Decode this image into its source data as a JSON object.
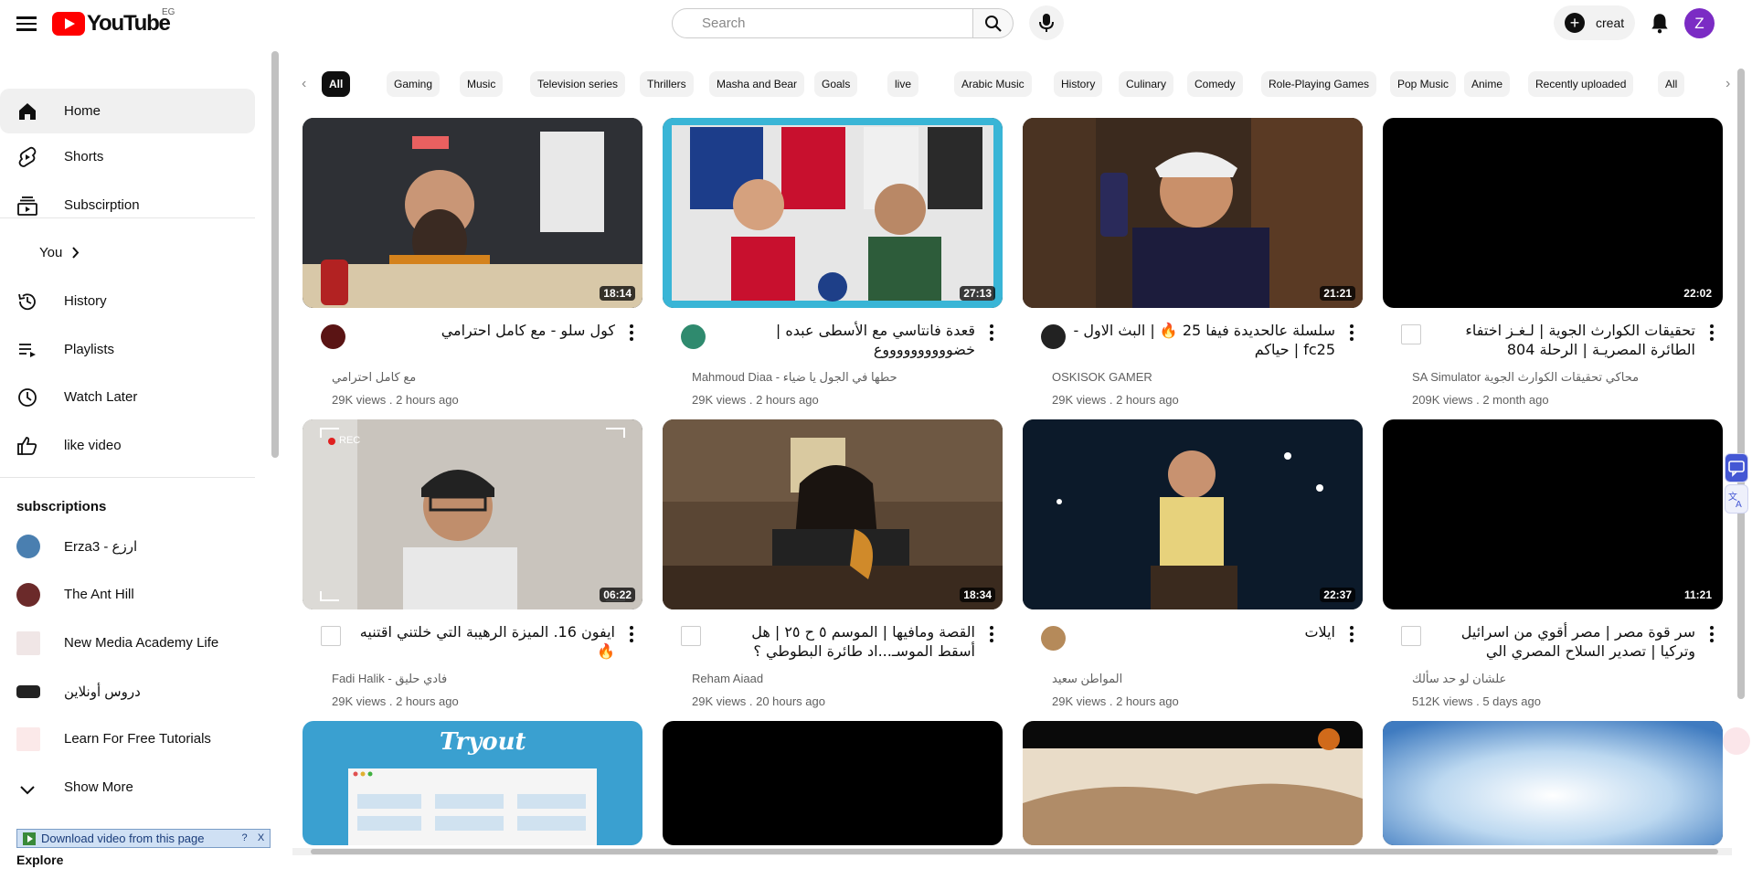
{
  "header": {
    "logo_text": "YouTube",
    "region": "EG",
    "search_placeholder": "Search",
    "create_label": "creat",
    "avatar_letter": "Z"
  },
  "colors": {
    "brand_red": "#ff0000",
    "avatar_purple": "#7b2bc4",
    "chip_active_bg": "#0f0f0f"
  },
  "sidebar": {
    "main": [
      {
        "label": "Home",
        "icon": "home-icon",
        "active": true
      },
      {
        "label": "Shorts",
        "icon": "shorts-icon"
      },
      {
        "label": "Subscirption",
        "icon": "subscriptions-icon"
      }
    ],
    "you_label": "You",
    "you_items": [
      {
        "label": "History",
        "icon": "history-icon"
      },
      {
        "label": "Playlists",
        "icon": "playlists-icon"
      },
      {
        "label": "Watch Later",
        "icon": "watch-later-icon"
      },
      {
        "label": "like video",
        "icon": "like-icon"
      }
    ],
    "subscriptions_heading": "subscriptions",
    "subscriptions": [
      {
        "label": "Erza3 - ارزع"
      },
      {
        "label": "The Ant Hill"
      },
      {
        "label": "New Media Academy Life"
      },
      {
        "label": "دروس أونلاين"
      },
      {
        "label": "Learn For Free Tutorials"
      }
    ],
    "show_more": "Show More",
    "explore": "Explore",
    "download_bar": "Download video from this page",
    "download_help": "?",
    "download_close": "X"
  },
  "chips": [
    "All",
    "Gaming",
    "Music",
    "Television series",
    "Thrillers",
    "Masha and Bear",
    "Goals",
    "live",
    "Arabic Music",
    "History",
    "Culinary",
    "Comedy",
    "Role-Playing Games",
    "Pop Music",
    "Anime",
    "Recently uploaded",
    "All"
  ],
  "videos": [
    {
      "title": "كول سلو - مع كامل احترامي",
      "channel": "مع كامل احترامي",
      "meta": "29K views . 2 hours ago",
      "duration": "18:14"
    },
    {
      "title": "قعدة فانتاسي مع الأسطى عبده | خضووووووووووع",
      "channel": "Mahmoud Diaa - حطها في الجول يا ضياء",
      "meta": "29K views . 2 hours ago",
      "duration": "27:13"
    },
    {
      "title": "سلسلة عالحديدة فيفا 25 🔥 | البث الاول - fc25 | حياكم",
      "channel": "OSKISOK GAMER",
      "meta": "29K views . 2 hours ago",
      "duration": "21:21"
    },
    {
      "title": "تحقيقات الكوارث الجوية | لـغـز اختفاء الطائرة المصريـة | الرحلة 804",
      "channel": "SA Simulator محاكي تحقيقات الكوارث الجوية",
      "meta": "209K views . 2 month ago",
      "duration": "22:02"
    },
    {
      "title": "ايفون 16. الميزة الرهيبة التي خلتني اقتنيه 🔥",
      "channel": "Fadi Halik - فادي حليق",
      "meta": "29K views . 2 hours ago",
      "duration": "06:22"
    },
    {
      "title": "القصة ومافيها | الموسم ٥ ح ٢٥ | هل أسقط الموسـ...اد طائرة البطوطي ؟",
      "channel": "Reham Aiaad",
      "meta": "29K views . 20 hours ago",
      "duration": "18:34"
    },
    {
      "title": "ايلات",
      "channel": "المواطن سعيد",
      "meta": "29K views . 2 hours ago",
      "duration": "22:37"
    },
    {
      "title": "سر قوة مصر | مصر أقوي من اسرائيل وتركيا | تصدير السلاح المصري الي",
      "channel": "علشان لو حد سألك",
      "meta": "512K views . 5 days ago",
      "duration": "11:21"
    }
  ],
  "thumb_texts": {
    "tryout": "Tryout",
    "rec": "REC"
  }
}
